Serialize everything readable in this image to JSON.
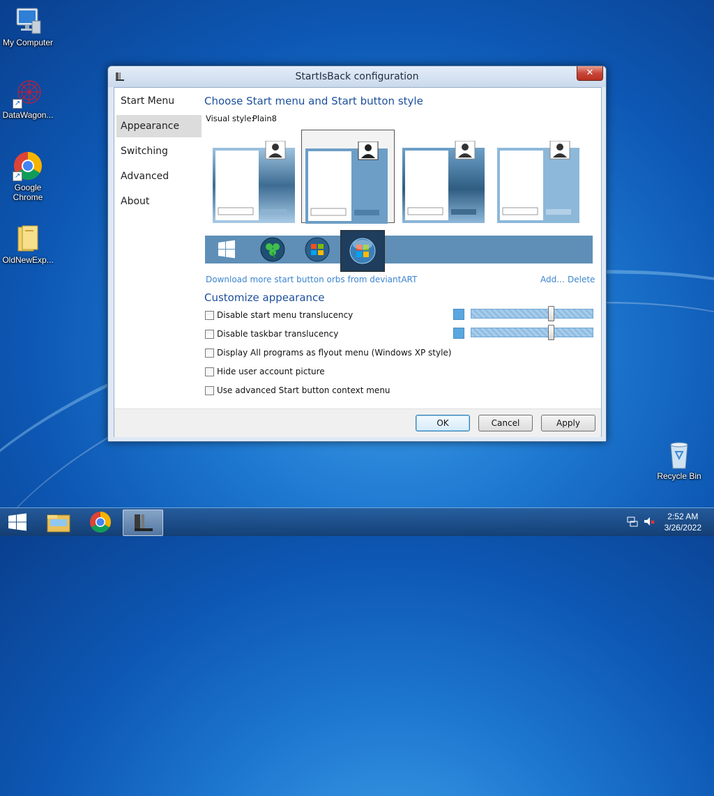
{
  "desktop": {
    "icons": [
      {
        "label": "My Computer"
      },
      {
        "label": "DataWagon..."
      },
      {
        "label": "Google Chrome"
      },
      {
        "label": "OldNewExp..."
      },
      {
        "label": "Recycle Bin"
      }
    ]
  },
  "window": {
    "title": "StartIsBack configuration",
    "close_glyph": "✕",
    "nav": [
      {
        "label": "Start Menu"
      },
      {
        "label": "Appearance"
      },
      {
        "label": "Switching"
      },
      {
        "label": "Advanced"
      },
      {
        "label": "About"
      }
    ],
    "style_section_title": "Choose Start menu and Start button style",
    "visual_style_label": "Visual style:",
    "visual_style_value": "Plain8",
    "download_link": "Download more start button orbs from deviantART",
    "add_link": "Add...",
    "delete_link": "Delete",
    "customize_title": "Customize appearance",
    "options": [
      {
        "label": "Disable start menu translucency",
        "checked": false
      },
      {
        "label": "Disable taskbar translucency",
        "checked": false
      },
      {
        "label": "Display All programs as flyout menu (Windows XP style)",
        "checked": false
      },
      {
        "label": "Hide user account picture",
        "checked": false
      },
      {
        "label": "Use advanced Start button context menu",
        "checked": false
      }
    ],
    "sliders": [
      {
        "level": 0.66
      },
      {
        "level": 0.66
      }
    ],
    "buttons": {
      "ok": "OK",
      "cancel": "Cancel",
      "apply": "Apply"
    }
  },
  "taskbar": {
    "time": "2:52 AM",
    "date": "3/26/2022"
  },
  "colors": {
    "accent_title": "#1c4f9c",
    "link": "#3d86cf",
    "orb_bar": "#5f8fb7"
  }
}
